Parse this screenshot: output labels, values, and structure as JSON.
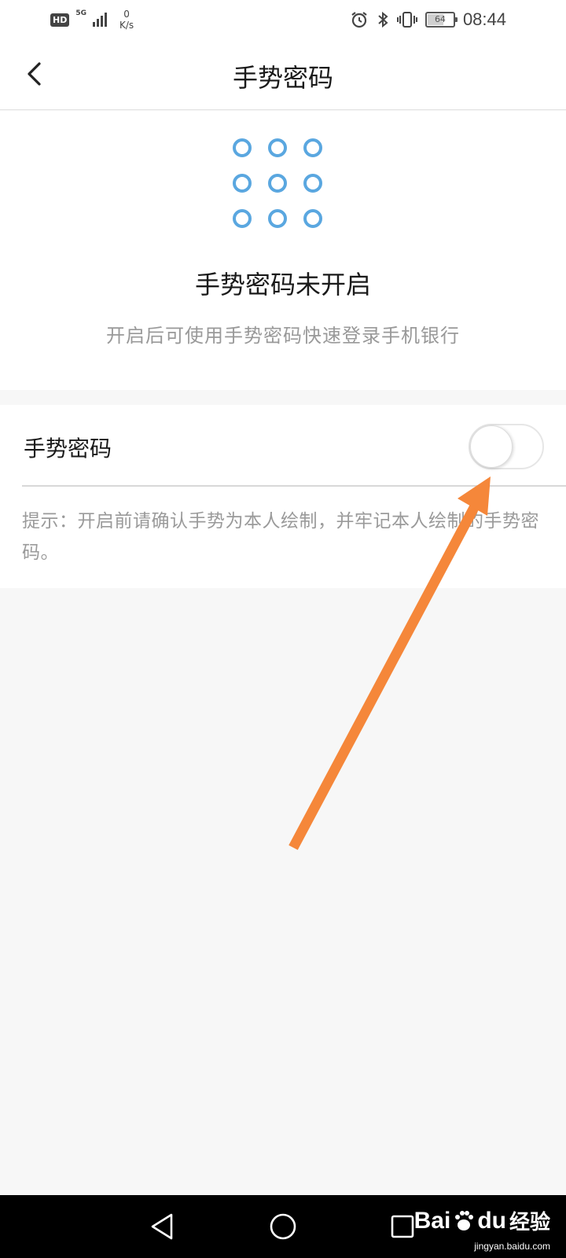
{
  "status_bar": {
    "hd": "HD",
    "network": "5G",
    "speed_value": "0",
    "speed_unit": "K/s",
    "battery": "64",
    "battery_level": 0.64,
    "time": "08:44",
    "icons": [
      "alarm-icon",
      "bluetooth-icon",
      "vibrate-icon"
    ]
  },
  "header": {
    "title": "手势密码",
    "back_icon": "chevron-left-icon"
  },
  "hero": {
    "title": "手势密码未开启",
    "subtitle": "开启后可使用手势密码快速登录手机银行",
    "accent_color": "#5aa7e0",
    "grid_icon": "gesture-grid-icon"
  },
  "setting": {
    "label": "手势密码",
    "toggle_on": false,
    "hint": "提示：开启前请确认手势为本人绘制，并牢记本人绘制的手势密码。"
  },
  "annotation": {
    "color": "#f5873a",
    "icon": "arrow-annotation-icon"
  },
  "system_nav": {
    "back_icon": "triangle-back-icon",
    "home_icon": "circle-home-icon",
    "recents_icon": "square-recents-icon"
  },
  "watermark": {
    "brand_left": "Bai",
    "brand_right": "du",
    "suffix": "经验",
    "url": "jingyan.baidu.com"
  }
}
